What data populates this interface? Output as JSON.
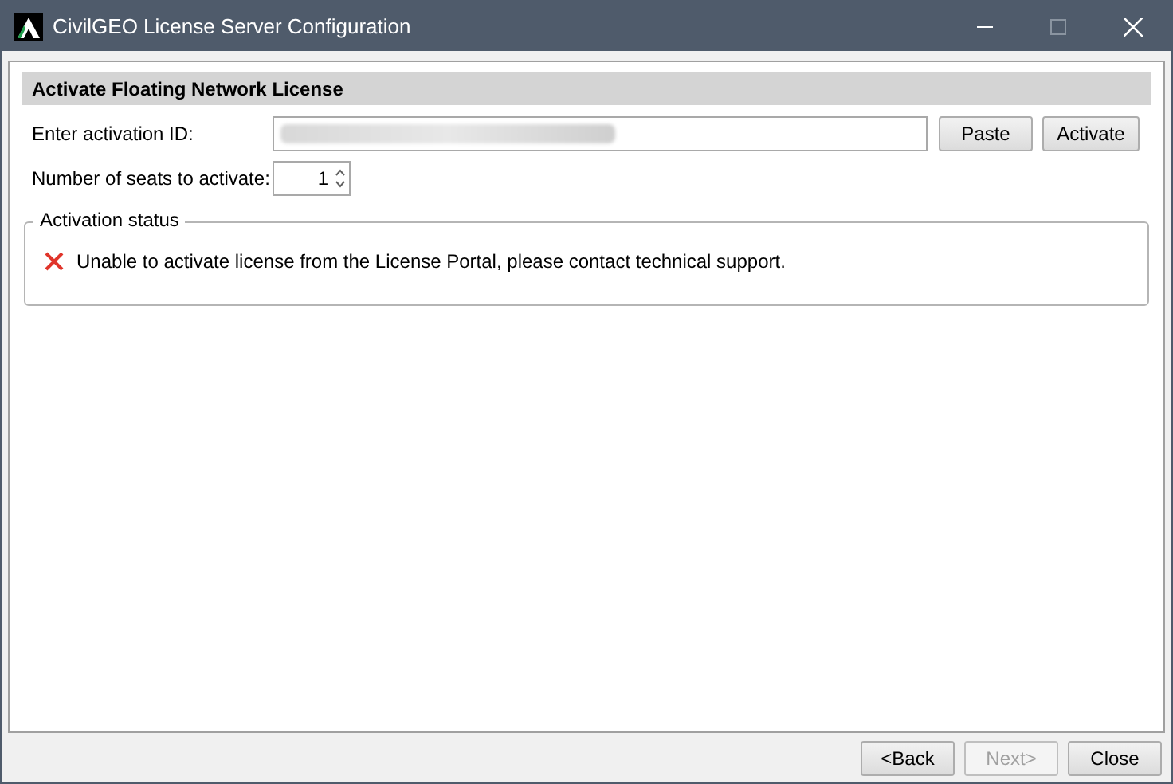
{
  "window": {
    "title": "CivilGEO License Server Configuration"
  },
  "section": {
    "title": "Activate Floating Network License"
  },
  "activation_id": {
    "label": "Enter activation ID:",
    "value_redacted": true
  },
  "buttons_row": [
    {
      "label": "Paste",
      "disabled": false
    },
    {
      "label": "Activate",
      "disabled": false
    }
  ],
  "seats": {
    "label": "Number of seats to activate:",
    "value": "1"
  },
  "status": {
    "title": "Activation status",
    "kind": "error",
    "message": "Unable to activate license from the License Portal, please contact technical support."
  },
  "footer_buttons": [
    {
      "label": "<Back",
      "disabled": false
    },
    {
      "label": "Next>",
      "disabled": true
    },
    {
      "label": "Close",
      "disabled": false
    }
  ]
}
